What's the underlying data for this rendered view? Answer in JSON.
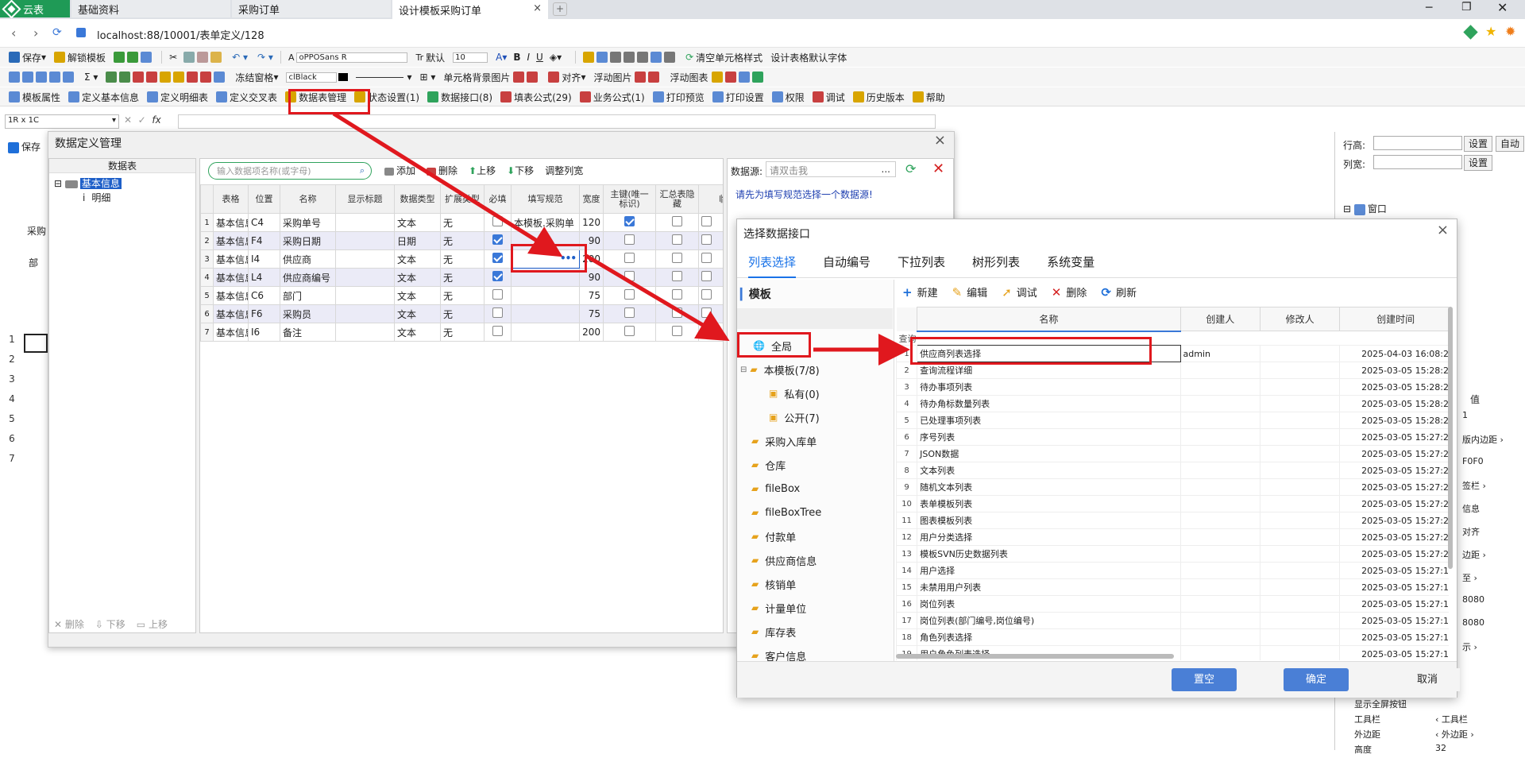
{
  "browser": {
    "app_tab": "云表",
    "tabs": [
      "基础资料",
      "采购订单",
      "设计模板采购订单"
    ],
    "url": "localhost:88/10001/表单定义/128"
  },
  "toolbar1": {
    "save": "保存",
    "unlock": "解锁模板",
    "font": "oPPOSans R",
    "default": "默认",
    "size": "10",
    "clear_style": "清空单元格样式",
    "design_font": "设计表格默认字体"
  },
  "toolbar2": {
    "freeze": "冻结窗格",
    "color_name": "clBlack",
    "cell_bg": "单元格背景图片",
    "align": "对齐",
    "float_img": "浮动图片",
    "float_chart": "浮动图表"
  },
  "toolbar3": {
    "items": [
      "模板属性",
      "定义基本信息",
      "定义明细表",
      "定义交叉表",
      "数据表管理",
      "状态设置(1)",
      "数据接口(8)",
      "填表公式(29)",
      "业务公式(1)",
      "打印预览",
      "打印设置",
      "权限",
      "调试",
      "历史版本",
      "帮助"
    ]
  },
  "formula_bar": {
    "cell_ref": "1R x 1C"
  },
  "left_bg": {
    "save": "保存",
    "caigou": "采购",
    "bu": "部",
    "rows": [
      "1",
      "2",
      "3",
      "4",
      "5",
      "6",
      "7"
    ]
  },
  "right_panel": {
    "row_height": "行高:",
    "col_width": "列宽:",
    "set": "设置",
    "auto": "自动",
    "window": "窗口",
    "value_header": "值",
    "props": [
      "1",
      "版内边距 ›",
      "F0F0",
      "签栏 ›",
      "信息",
      "对齐",
      "边距 ›",
      "至 ›",
      "8080",
      "8080",
      "示 ›"
    ],
    "bottom_rows": [
      {
        "k": "显示全屏按钮",
        "v": ""
      },
      {
        "k": "工具栏",
        "v": "‹ 工具栏"
      },
      {
        "k": "外边距",
        "v": "‹ 外边距 ›"
      },
      {
        "k": "高度",
        "v": "32"
      }
    ]
  },
  "dlg1": {
    "title": "数据定义管理",
    "tree_header": "数据表",
    "tree_root": "基本信息",
    "tree_child": "明细",
    "tree_actions": [
      "删除",
      "下移",
      "上移"
    ],
    "search_placeholder": "输入数据项名称(或字母)",
    "actions": [
      "添加",
      "删除",
      "上移",
      "下移",
      "调整列宽"
    ],
    "columns": [
      "表格",
      "位置",
      "名称",
      "显示标题",
      "数据类型",
      "扩展类型",
      "必填",
      "填写规范",
      "宽度",
      "主键(唯一标识)",
      "汇总表隐藏",
      "临时"
    ],
    "rows": [
      {
        "n": "1",
        "t": "基本信息",
        "p": "C4",
        "name": "采购单号",
        "type": "文本",
        "ext": "无",
        "req": false,
        "rule": "本模板.采购单",
        "w": "120",
        "pk": true
      },
      {
        "n": "2",
        "t": "基本信息",
        "p": "F4",
        "name": "采购日期",
        "type": "日期",
        "ext": "无",
        "req": true,
        "rule": "",
        "w": "90",
        "pk": false
      },
      {
        "n": "3",
        "t": "基本信息",
        "p": "I4",
        "name": "供应商",
        "type": "文本",
        "ext": "无",
        "req": true,
        "rule": "",
        "w": "200",
        "pk": false
      },
      {
        "n": "4",
        "t": "基本信息",
        "p": "L4",
        "name": "供应商编号",
        "type": "文本",
        "ext": "无",
        "req": true,
        "rule": "",
        "w": "90",
        "pk": false
      },
      {
        "n": "5",
        "t": "基本信息",
        "p": "C6",
        "name": "部门",
        "type": "文本",
        "ext": "无",
        "req": false,
        "rule": "",
        "w": "75",
        "pk": false
      },
      {
        "n": "6",
        "t": "基本信息",
        "p": "F6",
        "name": "采购员",
        "type": "文本",
        "ext": "无",
        "req": false,
        "rule": "",
        "w": "75",
        "pk": false
      },
      {
        "n": "7",
        "t": "基本信息",
        "p": "I6",
        "name": "备注",
        "type": "文本",
        "ext": "无",
        "req": false,
        "rule": "",
        "w": "200",
        "pk": false
      }
    ],
    "datasource_label": "数据源:",
    "datasource_placeholder": "请双击我",
    "datasource_hint": "请先为填写规范选择一个数据源!"
  },
  "dlg2": {
    "title": "选择数据接口",
    "tabs": [
      "列表选择",
      "自动编号",
      "下拉列表",
      "树形列表",
      "系统变量"
    ],
    "left_title": "模板",
    "tree": [
      {
        "label": "全局",
        "lvl": 0,
        "icon": "globe"
      },
      {
        "label": "本模板(7/8)",
        "lvl": 0,
        "icon": "folder"
      },
      {
        "label": "私有(0)",
        "lvl": 1,
        "icon": "lock"
      },
      {
        "label": "公开(7)",
        "lvl": 1,
        "icon": "lock"
      },
      {
        "label": "采购入库单",
        "lvl": 0,
        "icon": "folder"
      },
      {
        "label": "仓库",
        "lvl": 0,
        "icon": "folder"
      },
      {
        "label": "fileBox",
        "lvl": 0,
        "icon": "folder"
      },
      {
        "label": "fileBoxTree",
        "lvl": 0,
        "icon": "folder"
      },
      {
        "label": "付款单",
        "lvl": 0,
        "icon": "folder"
      },
      {
        "label": "供应商信息",
        "lvl": 0,
        "icon": "folder"
      },
      {
        "label": "核销单",
        "lvl": 0,
        "icon": "folder"
      },
      {
        "label": "计量单位",
        "lvl": 0,
        "icon": "folder"
      },
      {
        "label": "库存表",
        "lvl": 0,
        "icon": "folder"
      },
      {
        "label": "客户信息",
        "lvl": 0,
        "icon": "folder"
      }
    ],
    "actions": [
      "新建",
      "编辑",
      "调试",
      "删除",
      "刷新"
    ],
    "columns": [
      "名称",
      "创建人",
      "修改人",
      "创建时间"
    ],
    "query_label": "查询",
    "rows": [
      {
        "n": "1",
        "name": "供应商列表选择",
        "by": "admin",
        "time": "2025-04-03 16:08:2"
      },
      {
        "n": "2",
        "name": "查询流程详细",
        "by": "",
        "time": "2025-03-05 15:28:2"
      },
      {
        "n": "3",
        "name": "待办事项列表",
        "by": "",
        "time": "2025-03-05 15:28:2"
      },
      {
        "n": "4",
        "name": "待办角标数量列表",
        "by": "",
        "time": "2025-03-05 15:28:2"
      },
      {
        "n": "5",
        "name": "已处理事项列表",
        "by": "",
        "time": "2025-03-05 15:28:2"
      },
      {
        "n": "6",
        "name": "序号列表",
        "by": "",
        "time": "2025-03-05 15:27:2"
      },
      {
        "n": "7",
        "name": "JSON数据",
        "by": "",
        "time": "2025-03-05 15:27:2"
      },
      {
        "n": "8",
        "name": "文本列表",
        "by": "",
        "time": "2025-03-05 15:27:2"
      },
      {
        "n": "9",
        "name": "随机文本列表",
        "by": "",
        "time": "2025-03-05 15:27:2"
      },
      {
        "n": "10",
        "name": "表单模板列表",
        "by": "",
        "time": "2025-03-05 15:27:2"
      },
      {
        "n": "11",
        "name": "图表模板列表",
        "by": "",
        "time": "2025-03-05 15:27:2"
      },
      {
        "n": "12",
        "name": "用户分类选择",
        "by": "",
        "time": "2025-03-05 15:27:2"
      },
      {
        "n": "13",
        "name": "模板SVN历史数据列表",
        "by": "",
        "time": "2025-03-05 15:27:2"
      },
      {
        "n": "14",
        "name": "用户选择",
        "by": "",
        "time": "2025-03-05 15:27:1"
      },
      {
        "n": "15",
        "name": "未禁用用户列表",
        "by": "",
        "time": "2025-03-05 15:27:1"
      },
      {
        "n": "16",
        "name": "岗位列表",
        "by": "",
        "time": "2025-03-05 15:27:1"
      },
      {
        "n": "17",
        "name": "岗位列表(部门编号,岗位编号)",
        "by": "",
        "time": "2025-03-05 15:27:1"
      },
      {
        "n": "18",
        "name": "角色列表选择",
        "by": "",
        "time": "2025-03-05 15:27:1"
      },
      {
        "n": "19",
        "name": "用户角色列表选择",
        "by": "",
        "time": "2025-03-05 15:27:1"
      }
    ],
    "buttons": {
      "clear": "置空",
      "ok": "确定",
      "cancel": "取消"
    }
  },
  "colors": {
    "accent": "#3a78d8",
    "red": "#e0181e",
    "tab_active": "#1a73e8",
    "titlebar": "#dee1e6"
  }
}
